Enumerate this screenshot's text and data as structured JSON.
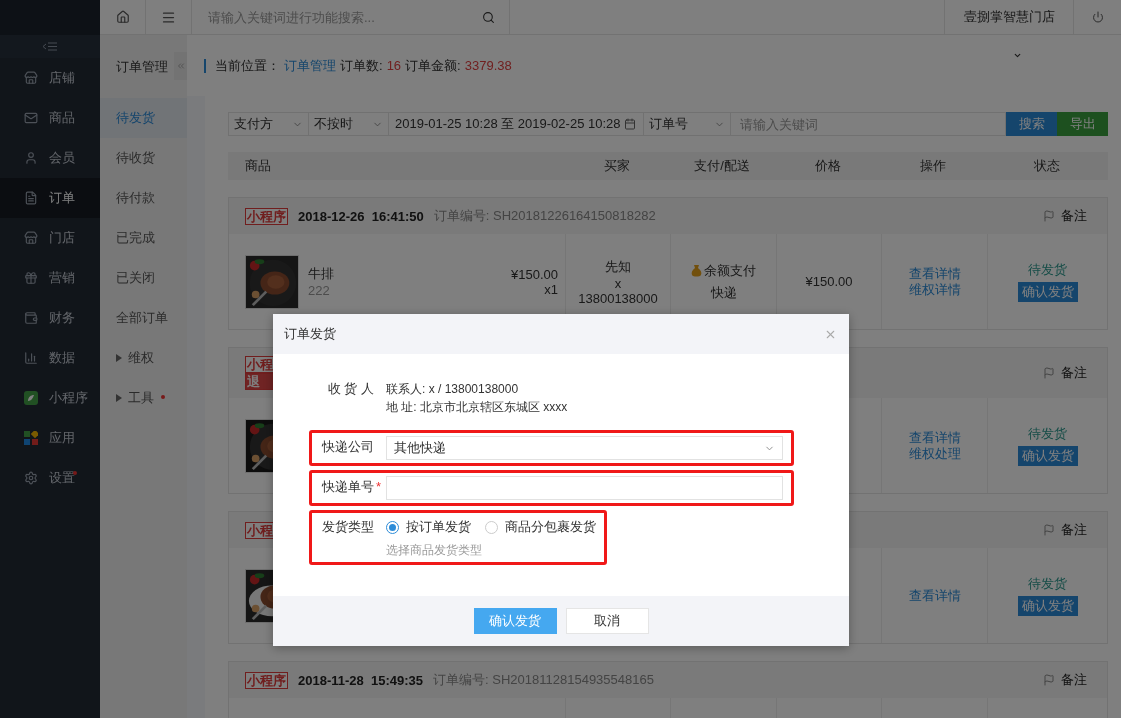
{
  "sidebar": {
    "items": [
      {
        "label": "店铺",
        "selected": false,
        "dot": false
      },
      {
        "label": "商品",
        "selected": false,
        "dot": false
      },
      {
        "label": "会员",
        "selected": false,
        "dot": false
      },
      {
        "label": "订单",
        "selected": true,
        "dot": false
      },
      {
        "label": "门店",
        "selected": false,
        "dot": false
      },
      {
        "label": "营销",
        "selected": false,
        "dot": false
      },
      {
        "label": "财务",
        "selected": false,
        "dot": false
      },
      {
        "label": "数据",
        "selected": false,
        "dot": false
      },
      {
        "label": "小程序",
        "selected": false,
        "dot": false
      },
      {
        "label": "应用",
        "selected": false,
        "dot": false
      },
      {
        "label": "设置",
        "selected": false,
        "dot": true
      }
    ]
  },
  "topbar": {
    "search_placeholder": "请输入关键词进行功能搜索...",
    "store_name": "壹捌掌智慧门店"
  },
  "subnav": {
    "title": "订单管理",
    "items": [
      {
        "label": "待发货",
        "kind": "link",
        "selected": true,
        "dot": false
      },
      {
        "label": "待收货",
        "kind": "link",
        "selected": false,
        "dot": false
      },
      {
        "label": "待付款",
        "kind": "link",
        "selected": false,
        "dot": false
      },
      {
        "label": "已完成",
        "kind": "link",
        "selected": false,
        "dot": false
      },
      {
        "label": "已关闭",
        "kind": "link",
        "selected": false,
        "dot": false
      },
      {
        "label": "全部订单",
        "kind": "link",
        "selected": false,
        "dot": false
      },
      {
        "label": "维权",
        "kind": "group",
        "selected": false,
        "dot": false
      },
      {
        "label": "工具",
        "kind": "group",
        "selected": false,
        "dot": true
      }
    ]
  },
  "breadcrumb": {
    "label": "当前位置：",
    "link": "订单管理",
    "count_label": "订单数:",
    "count": "16",
    "amount_label": "订单金额:",
    "amount": "3379.38"
  },
  "filters": {
    "payment": "支付方",
    "time": "不按时",
    "date_range": "2019-01-25 10:28 至 2019-02-25 10:28",
    "field": "订单号",
    "keyword_placeholder": "请输入关键词",
    "buttons": [
      {
        "label": "搜索",
        "kind": "primary"
      },
      {
        "label": "导出",
        "kind": "success"
      }
    ]
  },
  "table": {
    "columns": [
      "商品",
      "买家",
      "支付/配送",
      "价格",
      "操作",
      "状态"
    ]
  },
  "orders": [
    {
      "tags": [
        {
          "text": "小程序",
          "kind": "outline"
        }
      ],
      "date": "2018-12-26",
      "time": "16:41:50",
      "order_no": "订单编号: SH20181226164150818282",
      "remark": "备注",
      "image": {
        "kind": "picture"
      },
      "product": {
        "name": "牛排",
        "spec": "222",
        "price": "¥150.00",
        "qty": "x1"
      },
      "buyer": [
        "先知",
        "x",
        "13800138000"
      ],
      "payment": "余额支付",
      "delivery": "快递",
      "price": "¥150.00",
      "actions": [
        "查看详情",
        "维权详情"
      ],
      "status": "待发货",
      "button": "确认发货"
    },
    {
      "tags": [
        {
          "text": "小程",
          "kind": "outline"
        },
        {
          "text": "退",
          "kind": "filled"
        }
      ],
      "remark": "备注",
      "image": {
        "kind": "picture"
      },
      "actions": [
        "查看详情",
        "维权处理"
      ],
      "status": "待发货",
      "button": "确认发货"
    },
    {
      "tags": [
        {
          "text": "小程",
          "kind": "outline"
        }
      ],
      "remark": "备注",
      "image": {
        "kind": "picture"
      },
      "actions": [
        "查看详情"
      ],
      "status": "待发货",
      "button": "确认发货"
    },
    {
      "tags": [
        {
          "text": "小程序",
          "kind": "outline"
        }
      ],
      "date": "2018-11-28",
      "time": "15:49:35",
      "order_no": "订单编号: SH20181128154935548165",
      "remark": "备注"
    }
  ],
  "dialog": {
    "title": "订单发货",
    "receiver_label": "收 货 人",
    "contact": "联系人: x / 13800138000",
    "address": "地 址: 北京市北京辖区东城区 xxxx",
    "company": {
      "label": "快递公司",
      "value": "其他快递",
      "highlighted": true
    },
    "tracking": {
      "label": "快递单号",
      "required_mark": "*",
      "highlighted": true
    },
    "type": {
      "label": "发货类型",
      "highlighted": true,
      "options": [
        {
          "label": "按订单发货",
          "selected": true
        },
        {
          "label": "商品分包裹发货",
          "selected": false
        }
      ],
      "hint": "选择商品发货类型"
    },
    "buttons": [
      {
        "label": "确认发货",
        "kind": "primary"
      },
      {
        "label": "取消",
        "kind": "default"
      }
    ]
  }
}
